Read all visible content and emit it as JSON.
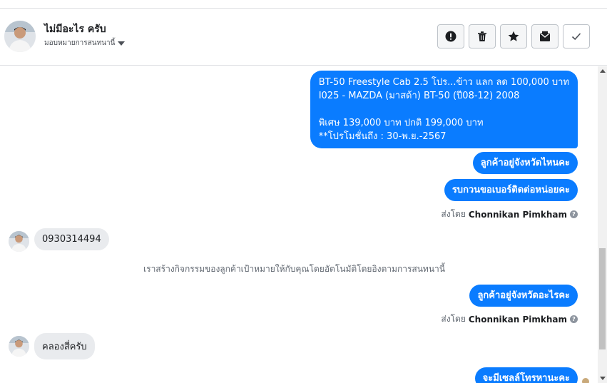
{
  "header": {
    "contact_name": "ไม่มีอะไร ครับ",
    "assign_label": "มอบหมายการสนทนานี้",
    "actions": [
      {
        "name": "mark-spam",
        "icon": "exclamation-icon"
      },
      {
        "name": "delete",
        "icon": "trash-icon"
      },
      {
        "name": "star",
        "icon": "star-icon"
      },
      {
        "name": "move-to-inbox",
        "icon": "mail-icon"
      },
      {
        "name": "mark-done",
        "icon": "check-icon"
      }
    ]
  },
  "messages": {
    "promo": {
      "line1": "BT-50 Freestyle Cab 2.5 โปร...ข้าว แลก ลด 100,000 บาท",
      "line2": "I025 - MAZDA (มาสด้า) BT-50 (ปี08-12) 2008",
      "line3": "พิเศษ 139,000 บาท  ปกติ 199,000 บาท",
      "line4": "**โปรโมชั่นถึง : 30-พ.ย.-2567"
    },
    "ask_province": "ลูกค้าอยู่จังหวัดไหนคะ",
    "ask_phone": "รบกวนขอเบอร์ติดต่อหน่อยคะ",
    "sent_by_prefix": "ส่งโดย",
    "sent_by_name": "Chonnikan Pimkham",
    "customer_phone": "0930314494",
    "system_note": "เราสร้างกิจกรรมของลูกค้าเป้าหมายให้กับคุณโดยอัตโนมัติโดยอิงตามการสนทนานี้",
    "ask_province2": "ลูกค้าอยู่จังหวัดอะไรคะ",
    "sent_by_prefix2": "ส่งโดย",
    "sent_by_name2": "Chonnikan Pimkham",
    "customer_reply": "คลองสี่ครับ",
    "last_out": "จะมีเซลล์โทรหานะคะ"
  },
  "colors": {
    "outgoing_bubble": "#0a7cff",
    "incoming_bubble": "#e9ebee"
  }
}
